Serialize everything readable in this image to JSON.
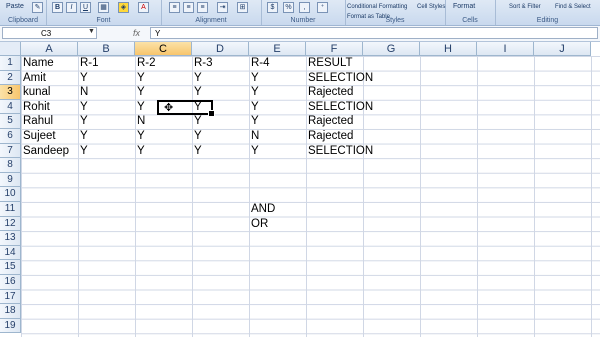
{
  "ribbon": {
    "clipboard": {
      "paste": "Paste",
      "label": "Clipboard"
    },
    "font": {
      "label": "Font",
      "bold": "B",
      "italic": "I",
      "underline": "U"
    },
    "alignment": {
      "label": "Alignment"
    },
    "number": {
      "label": "Number",
      "percent": "%"
    },
    "styles": {
      "label": "Styles",
      "conditional": "Conditional Formatting",
      "format_table": "Format as Table",
      "cell_styles": "Cell Styles"
    },
    "cells": {
      "label": "Cells",
      "format": "Format"
    },
    "editing": {
      "label": "Editing",
      "sort": "Sort & Filter",
      "find": "Find & Select"
    }
  },
  "formula_bar": {
    "name_box": "C3",
    "fx": "fx",
    "content": "Y"
  },
  "columns": [
    "A",
    "B",
    "C",
    "D",
    "E",
    "F",
    "G",
    "H",
    "I",
    "J"
  ],
  "rows": [
    "1",
    "2",
    "3",
    "4",
    "5",
    "6",
    "7",
    "8",
    "9",
    "10",
    "11",
    "12",
    "13",
    "14",
    "15",
    "16",
    "17",
    "18",
    "19"
  ],
  "table": {
    "header": [
      "Name",
      "R-1",
      "R-2",
      "R-3",
      "R-4",
      "RESULT"
    ],
    "rows": [
      [
        "Amit",
        "Y",
        "Y",
        "Y",
        "Y",
        "SELECTION"
      ],
      [
        "kunal",
        "N",
        "Y",
        "Y",
        "Y",
        "Rajected"
      ],
      [
        "Rohit",
        "Y",
        "Y",
        "Y",
        "Y",
        "SELECTION"
      ],
      [
        "Rahul",
        "Y",
        "N",
        "Y",
        "Y",
        "Rajected"
      ],
      [
        "Sujeet",
        "Y",
        "Y",
        "Y",
        "N",
        "Rajected"
      ],
      [
        "Sandeep",
        "Y",
        "Y",
        "Y",
        "Y",
        "SELECTION"
      ]
    ]
  },
  "notes": {
    "e11": "AND",
    "e12": "OR"
  },
  "selection": {
    "cell": "C3",
    "column": "C",
    "row": "3"
  }
}
